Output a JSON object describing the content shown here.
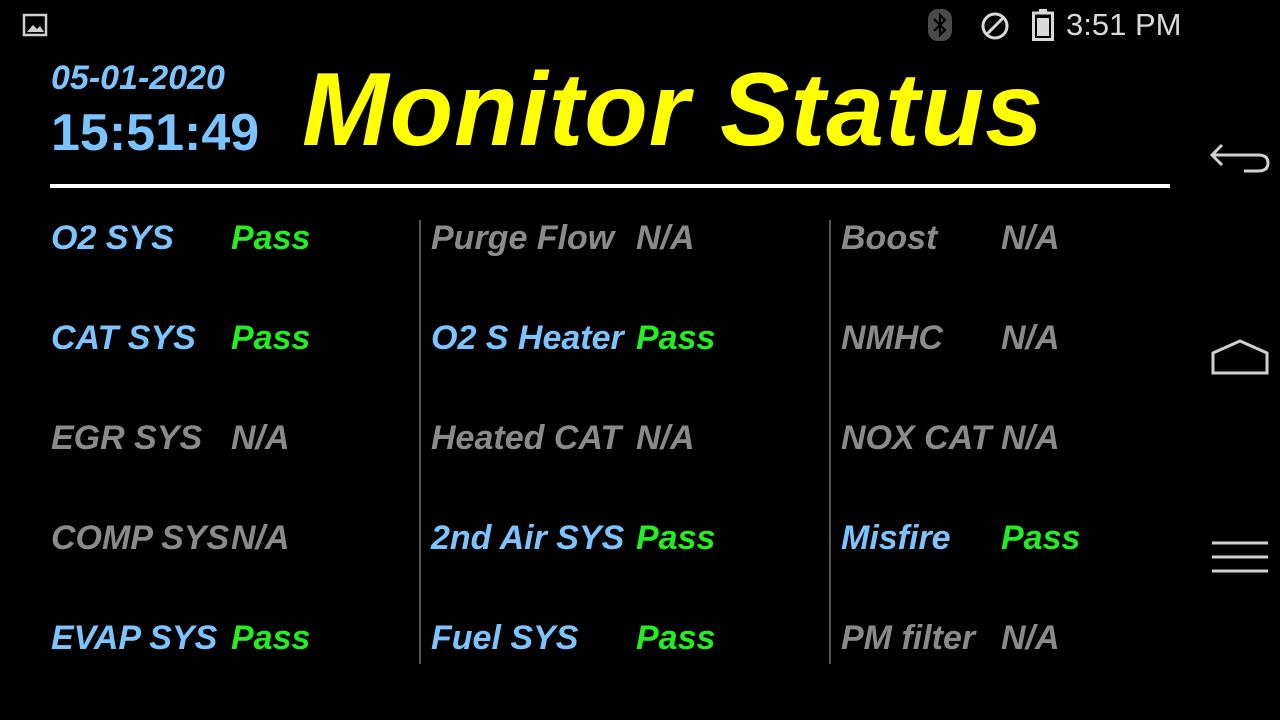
{
  "status_bar": {
    "time": "3:51 PM",
    "icons": [
      "gallery-icon",
      "bluetooth-icon",
      "do-not-disturb-icon",
      "battery-icon"
    ]
  },
  "header": {
    "date": "05-01-2020",
    "time": "15:51:49",
    "title": "Monitor Status"
  },
  "colors": {
    "title": "#ffff00",
    "active_label": "#7cc4ff",
    "inactive": "#8a8a8a",
    "pass": "#22ee22"
  },
  "monitors": {
    "col1": [
      {
        "label": "O2 SYS",
        "value": "Pass"
      },
      {
        "label": "CAT SYS",
        "value": "Pass"
      },
      {
        "label": "EGR SYS",
        "value": "N/A"
      },
      {
        "label": "COMP SYS",
        "value": "N/A"
      },
      {
        "label": "EVAP SYS",
        "value": "Pass"
      }
    ],
    "col2": [
      {
        "label": "Purge Flow",
        "value": "N/A"
      },
      {
        "label": "O2 S Heater",
        "value": "Pass"
      },
      {
        "label": "Heated CAT",
        "value": "N/A"
      },
      {
        "label": "2nd Air SYS",
        "value": "Pass"
      },
      {
        "label": "Fuel SYS",
        "value": "Pass"
      }
    ],
    "col3": [
      {
        "label": "Boost",
        "value": "N/A"
      },
      {
        "label": "NMHC",
        "value": "N/A"
      },
      {
        "label": "NOX CAT",
        "value": "N/A"
      },
      {
        "label": "Misfire",
        "value": "Pass"
      },
      {
        "label": "PM filter",
        "value": "N/A"
      }
    ]
  },
  "nav_bar": {
    "buttons": [
      "back-icon",
      "home-icon",
      "menu-icon"
    ]
  }
}
